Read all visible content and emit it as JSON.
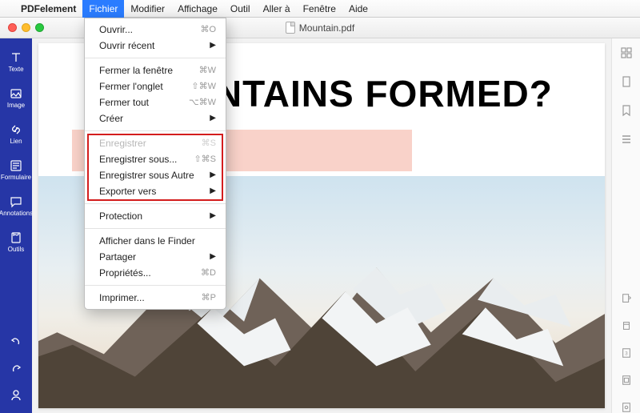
{
  "menubar": {
    "apple": "",
    "app_name": "PDFelement",
    "items": [
      "Fichier",
      "Modifier",
      "Affichage",
      "Outil",
      "Aller à",
      "Fenêtre",
      "Aide"
    ],
    "open_index": 0
  },
  "document": {
    "title": "Mountain.pdf"
  },
  "sidebar": {
    "items": [
      {
        "label": "Texte",
        "icon": "text"
      },
      {
        "label": "Image",
        "icon": "image"
      },
      {
        "label": "Lien",
        "icon": "link"
      },
      {
        "label": "Formulaire",
        "icon": "form"
      },
      {
        "label": "Annotations",
        "icon": "annotations"
      },
      {
        "label": "Outils",
        "icon": "tools"
      }
    ],
    "bottom_icons": [
      "undo",
      "redo",
      "user"
    ]
  },
  "file_menu": {
    "groups": [
      [
        {
          "label": "Ouvrir...",
          "shortcut": "⌘O"
        },
        {
          "label": "Ouvrir récent",
          "submenu": true
        }
      ],
      [
        {
          "label": "Fermer la fenêtre",
          "shortcut": "⌘W"
        },
        {
          "label": "Fermer l'onglet",
          "shortcut": "⇧⌘W"
        },
        {
          "label": "Fermer tout",
          "shortcut": "⌥⌘W"
        },
        {
          "label": "Créer",
          "submenu": true
        }
      ],
      [
        {
          "label": "Enregistrer",
          "shortcut": "⌘S",
          "disabled": true
        },
        {
          "label": "Enregistrer sous...",
          "shortcut": "⇧⌘S"
        },
        {
          "label": "Enregistrer sous Autre",
          "submenu": true
        },
        {
          "label": "Exporter vers",
          "submenu": true
        }
      ],
      [
        {
          "label": "Protection",
          "submenu": true
        }
      ],
      [
        {
          "label": "Afficher dans le Finder"
        },
        {
          "label": "Partager",
          "submenu": true
        },
        {
          "label": "Propriétés...",
          "shortcut": "⌘D"
        }
      ],
      [
        {
          "label": "Imprimer...",
          "shortcut": "⌘P"
        }
      ]
    ]
  },
  "page": {
    "heading_visible": "E MOUNTAINS FORMED?"
  },
  "highlight": {
    "group_index": 2
  },
  "right_rail": {
    "top_icons": [
      "thumbnails",
      "page",
      "bookmark",
      "list"
    ],
    "bottom_icons": [
      "export",
      "crop",
      "page-fit",
      "page-width",
      "zoom"
    ]
  }
}
